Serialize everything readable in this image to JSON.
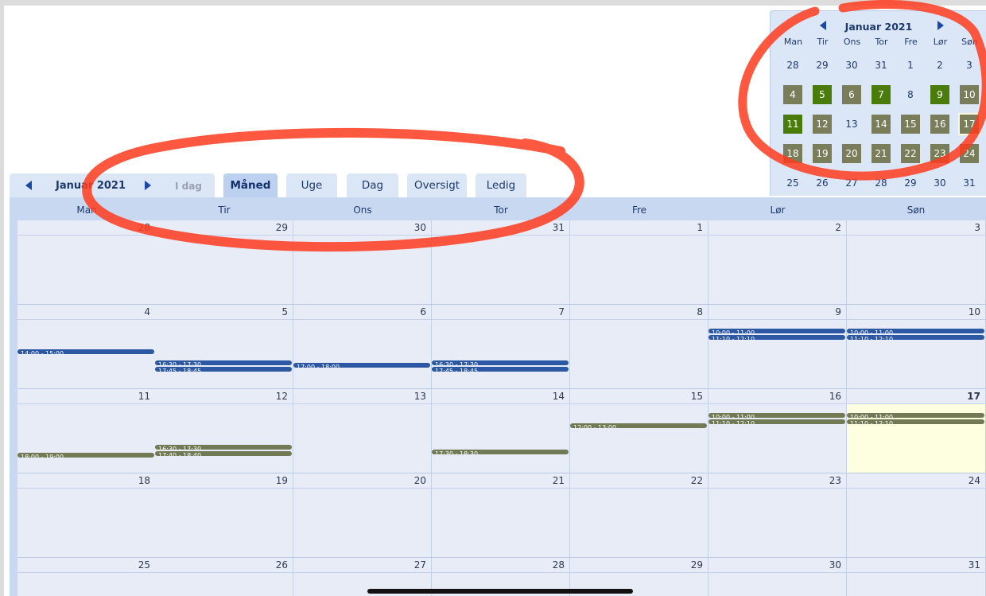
{
  "mini_calendar": {
    "title": "Januar 2021",
    "weekdays": [
      "Man",
      "Tir",
      "Ons",
      "Tor",
      "Fre",
      "Lør",
      "Søn"
    ],
    "weeks": [
      [
        {
          "d": "28",
          "s": "plain"
        },
        {
          "d": "29",
          "s": "plain"
        },
        {
          "d": "30",
          "s": "plain"
        },
        {
          "d": "31",
          "s": "plain"
        },
        {
          "d": "1",
          "s": "plain"
        },
        {
          "d": "2",
          "s": "plain"
        },
        {
          "d": "3",
          "s": "plain"
        }
      ],
      [
        {
          "d": "4",
          "s": "event"
        },
        {
          "d": "5",
          "s": "green"
        },
        {
          "d": "6",
          "s": "event"
        },
        {
          "d": "7",
          "s": "green"
        },
        {
          "d": "8",
          "s": "plain"
        },
        {
          "d": "9",
          "s": "green"
        },
        {
          "d": "10",
          "s": "event"
        }
      ],
      [
        {
          "d": "11",
          "s": "green"
        },
        {
          "d": "12",
          "s": "event"
        },
        {
          "d": "13",
          "s": "plain"
        },
        {
          "d": "14",
          "s": "event"
        },
        {
          "d": "15",
          "s": "event"
        },
        {
          "d": "16",
          "s": "event"
        },
        {
          "d": "17",
          "s": "today"
        }
      ],
      [
        {
          "d": "18",
          "s": "event"
        },
        {
          "d": "19",
          "s": "event"
        },
        {
          "d": "20",
          "s": "event"
        },
        {
          "d": "21",
          "s": "event"
        },
        {
          "d": "22",
          "s": "event"
        },
        {
          "d": "23",
          "s": "event"
        },
        {
          "d": "24",
          "s": "event"
        }
      ],
      [
        {
          "d": "25",
          "s": "plain"
        },
        {
          "d": "26",
          "s": "plain"
        },
        {
          "d": "27",
          "s": "plain"
        },
        {
          "d": "28",
          "s": "plain"
        },
        {
          "d": "29",
          "s": "plain"
        },
        {
          "d": "30",
          "s": "plain"
        },
        {
          "d": "31",
          "s": "plain"
        }
      ]
    ]
  },
  "toolbar": {
    "month_title": "Januar 2021",
    "today_label": "I dag",
    "tabs": [
      "Måned",
      "Uge",
      "Dag",
      "Oversigt",
      "Ledig"
    ],
    "active_tab": "Måned"
  },
  "month": {
    "weekdays": [
      "Man",
      "Tir",
      "Ons",
      "Tor",
      "Fre",
      "Lør",
      "Søn"
    ],
    "today": "17",
    "weeks": [
      [
        "28",
        "29",
        "30",
        "31",
        "1",
        "2",
        "3"
      ],
      [
        "4",
        "5",
        "6",
        "7",
        "8",
        "9",
        "10"
      ],
      [
        "11",
        "12",
        "13",
        "14",
        "15",
        "16",
        "17"
      ],
      [
        "18",
        "19",
        "20",
        "21",
        "22",
        "23",
        "24"
      ],
      [
        "25",
        "26",
        "27",
        "28",
        "29",
        "30",
        "31"
      ]
    ],
    "events": [
      {
        "week": 1,
        "day": 0,
        "slot": 38,
        "time": "14:00 - 15:00",
        "color": "#2c57a2"
      },
      {
        "week": 1,
        "day": 1,
        "slot": 52,
        "time": "16:30 - 17:30",
        "color": "#2c57a2"
      },
      {
        "week": 1,
        "day": 1,
        "slot": 60,
        "time": "17:45 - 18:45",
        "color": "#2c57a2"
      },
      {
        "week": 1,
        "day": 2,
        "slot": 55,
        "time": "17:00 - 18:00",
        "color": "#2c57a2"
      },
      {
        "week": 1,
        "day": 3,
        "slot": 52,
        "time": "16:30 - 17:30",
        "color": "#2c57a2"
      },
      {
        "week": 1,
        "day": 3,
        "slot": 60,
        "time": "17:45 - 18:45",
        "color": "#2c57a2"
      },
      {
        "week": 1,
        "day": 5,
        "slot": 12,
        "time": "10:00 - 11:00",
        "color": "#2c57a2"
      },
      {
        "week": 1,
        "day": 5,
        "slot": 20,
        "time": "11:10 - 12:10",
        "color": "#2c57a2"
      },
      {
        "week": 1,
        "day": 6,
        "slot": 12,
        "time": "10:00 - 11:00",
        "color": "#2c57a2"
      },
      {
        "week": 1,
        "day": 6,
        "slot": 20,
        "time": "11:10 - 12:10",
        "color": "#2c57a2"
      },
      {
        "week": 2,
        "day": 0,
        "slot": 62,
        "time": "18:00 - 19:00",
        "color": "#717a55"
      },
      {
        "week": 2,
        "day": 1,
        "slot": 52,
        "time": "16:30 - 17:30",
        "color": "#717a55"
      },
      {
        "week": 2,
        "day": 1,
        "slot": 60,
        "time": "17:40 - 18:40",
        "color": "#717a55"
      },
      {
        "week": 2,
        "day": 3,
        "slot": 58,
        "time": "17:30 - 18:30",
        "color": "#717a55"
      },
      {
        "week": 2,
        "day": 4,
        "slot": 25,
        "time": "12:00 - 13:00",
        "color": "#717a55"
      },
      {
        "week": 2,
        "day": 5,
        "slot": 12,
        "time": "10:00 - 11:00",
        "color": "#717a55"
      },
      {
        "week": 2,
        "day": 5,
        "slot": 20,
        "time": "11:10 - 12:10",
        "color": "#717a55"
      },
      {
        "week": 2,
        "day": 6,
        "slot": 12,
        "time": "10:00 - 11:00",
        "color": "#717a55"
      },
      {
        "week": 2,
        "day": 6,
        "slot": 20,
        "time": "11:10 - 12:10",
        "color": "#717a55"
      }
    ]
  },
  "colors": {
    "event_blue": "#2c57a2",
    "event_olive": "#717a55",
    "mini_green": "#4a7c0b",
    "today_highlight": "#fefee0",
    "annotation": "#ff3b1f"
  }
}
